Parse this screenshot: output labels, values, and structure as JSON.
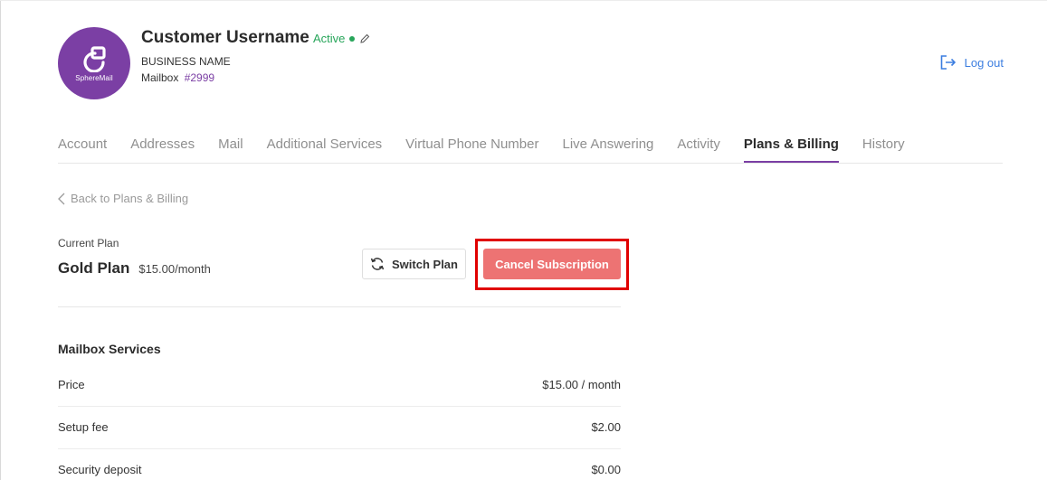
{
  "header": {
    "avatar_brand": "SphereMail",
    "customer_name": "Customer Username",
    "status": "Active",
    "business_name": "BUSINESS NAME",
    "mailbox_label": "Mailbox",
    "mailbox_number": "#2999",
    "logout_label": "Log out"
  },
  "tabs": [
    {
      "label": "Account"
    },
    {
      "label": "Addresses"
    },
    {
      "label": "Mail"
    },
    {
      "label": "Additional Services"
    },
    {
      "label": "Virtual Phone Number"
    },
    {
      "label": "Live Answering"
    },
    {
      "label": "Activity"
    },
    {
      "label": "Plans & Billing",
      "active": true
    },
    {
      "label": "History"
    }
  ],
  "back_link": "Back to Plans & Billing",
  "plan": {
    "current_label": "Current Plan",
    "name": "Gold Plan",
    "price": "$15.00/month",
    "switch_label": "Switch Plan",
    "cancel_label": "Cancel Subscription"
  },
  "services": {
    "title": "Mailbox Services",
    "rows": [
      {
        "label": "Price",
        "value": "$15.00 / month"
      },
      {
        "label": "Setup fee",
        "value": "$2.00"
      },
      {
        "label": "Security deposit",
        "value": "$0.00"
      }
    ]
  },
  "colors": {
    "brand": "#7b3fa4",
    "active_status": "#27a55a",
    "link": "#3c7ee0",
    "cancel_button": "#ed7373",
    "highlight": "#e00000"
  },
  "icons": {
    "edit": "pencil-icon",
    "logout": "logout-icon",
    "back": "chevron-left-icon",
    "switch": "refresh-icon"
  }
}
